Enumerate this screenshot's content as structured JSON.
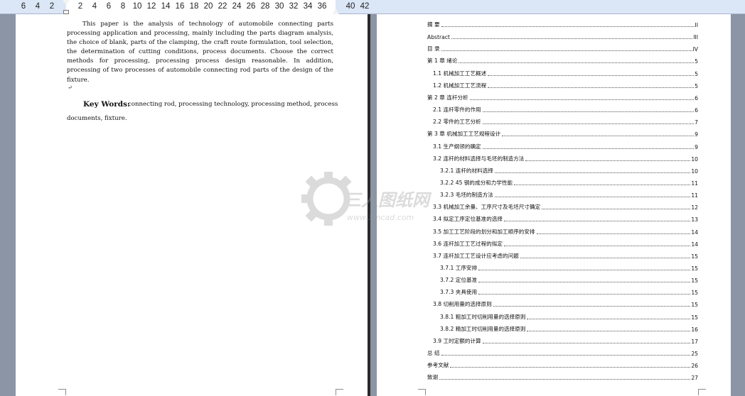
{
  "ruler": {
    "labels": [
      "6",
      "4",
      "2",
      "2",
      "4",
      "6",
      "8",
      "10",
      "12",
      "14",
      "16",
      "18",
      "20",
      "22",
      "24",
      "26",
      "28",
      "30",
      "32",
      "34",
      "36",
      "40",
      "42"
    ]
  },
  "left_page": {
    "abstract_text": "This paper is the analysis of technology of automobile connecting parts processing application and processing, mainly including the parts diagram analysis, the choice of blank, parts of the clamping, the craft route formulation, tool selection, the determination of cutting conditions, process documents. Choose the correct methods for processing, processing process design reasonable. In addition, processing of two processes of automobile connecting rod parts of the design of the fixture.",
    "para_mark": "↵",
    "keywords_label": "Key Words:",
    "keywords_text": "connecting rod, processing technology, processing method, process",
    "keywords_cont": "documents,  fixture."
  },
  "toc": [
    {
      "label": "摘    要",
      "page": "II"
    },
    {
      "label": "Abstract",
      "page": "III"
    },
    {
      "label": "目    录",
      "page": "IV"
    },
    {
      "label": "第 1 章  绪论",
      "page": "5"
    },
    {
      "label": "1.1  机械加工工艺概述",
      "page": "5"
    },
    {
      "label": "1.2 机械加工工艺流程",
      "page": "5"
    },
    {
      "label": "第 2 章  连杆分析",
      "page": "6"
    },
    {
      "label": "2.1  连杆零件的作用",
      "page": "6"
    },
    {
      "label": "2.2 零件的工艺分析",
      "page": "7"
    },
    {
      "label": "第 3 章    机械加工工艺规程设计",
      "page": "9"
    },
    {
      "label": "3.1  生产纲领的确定",
      "page": "9"
    },
    {
      "label": "3.2  连杆的材料选择与毛坯的制造方法",
      "page": "10"
    },
    {
      "label": "3.2.1 连杆的材料选择",
      "page": "10"
    },
    {
      "label": "3.2.2 45 钢的成分和力学性能",
      "page": "11"
    },
    {
      "label": "3.2.3  毛坯的制造方法",
      "page": "11"
    },
    {
      "label": "3.3  机械加工余量、工序尺寸及毛坯尺寸确定",
      "page": "12"
    },
    {
      "label": "3.4  拟定工序定位基准的选择",
      "page": "13"
    },
    {
      "label": "3.5  加工工艺阶段的划分和加工顺序的安排",
      "page": "14"
    },
    {
      "label": "3.6  连杆加工工艺过程的拟定",
      "page": "14"
    },
    {
      "label": "3.7  连杆加工工艺设计应考虑的问题",
      "page": "15"
    },
    {
      "label": "3.7.1     工序安排",
      "page": "15"
    },
    {
      "label": "3.7.2     定位基准",
      "page": "15"
    },
    {
      "label": "3.7.3     夹具使用",
      "page": "15"
    },
    {
      "label": "3.8  切削用量的选择原则",
      "page": "15"
    },
    {
      "label": "3.8.1  粗加工时切削用量的选择原则",
      "page": "15"
    },
    {
      "label": "3.8.2  精加工时切削用量的选择原则",
      "page": "16"
    },
    {
      "label": "3.9  工时定额的计算",
      "page": "17"
    },
    {
      "label": "总    结",
      "page": "25"
    },
    {
      "label": "参考文献",
      "page": "26"
    },
    {
      "label": "致谢",
      "page": "27"
    }
  ],
  "watermark": {
    "brand": "三人图纸网",
    "url": "www.3mcad.com"
  },
  "colors": {
    "workspace": "#8b95a6",
    "ruler": "#dbe6f6",
    "watermark": "#9a9a9a"
  }
}
